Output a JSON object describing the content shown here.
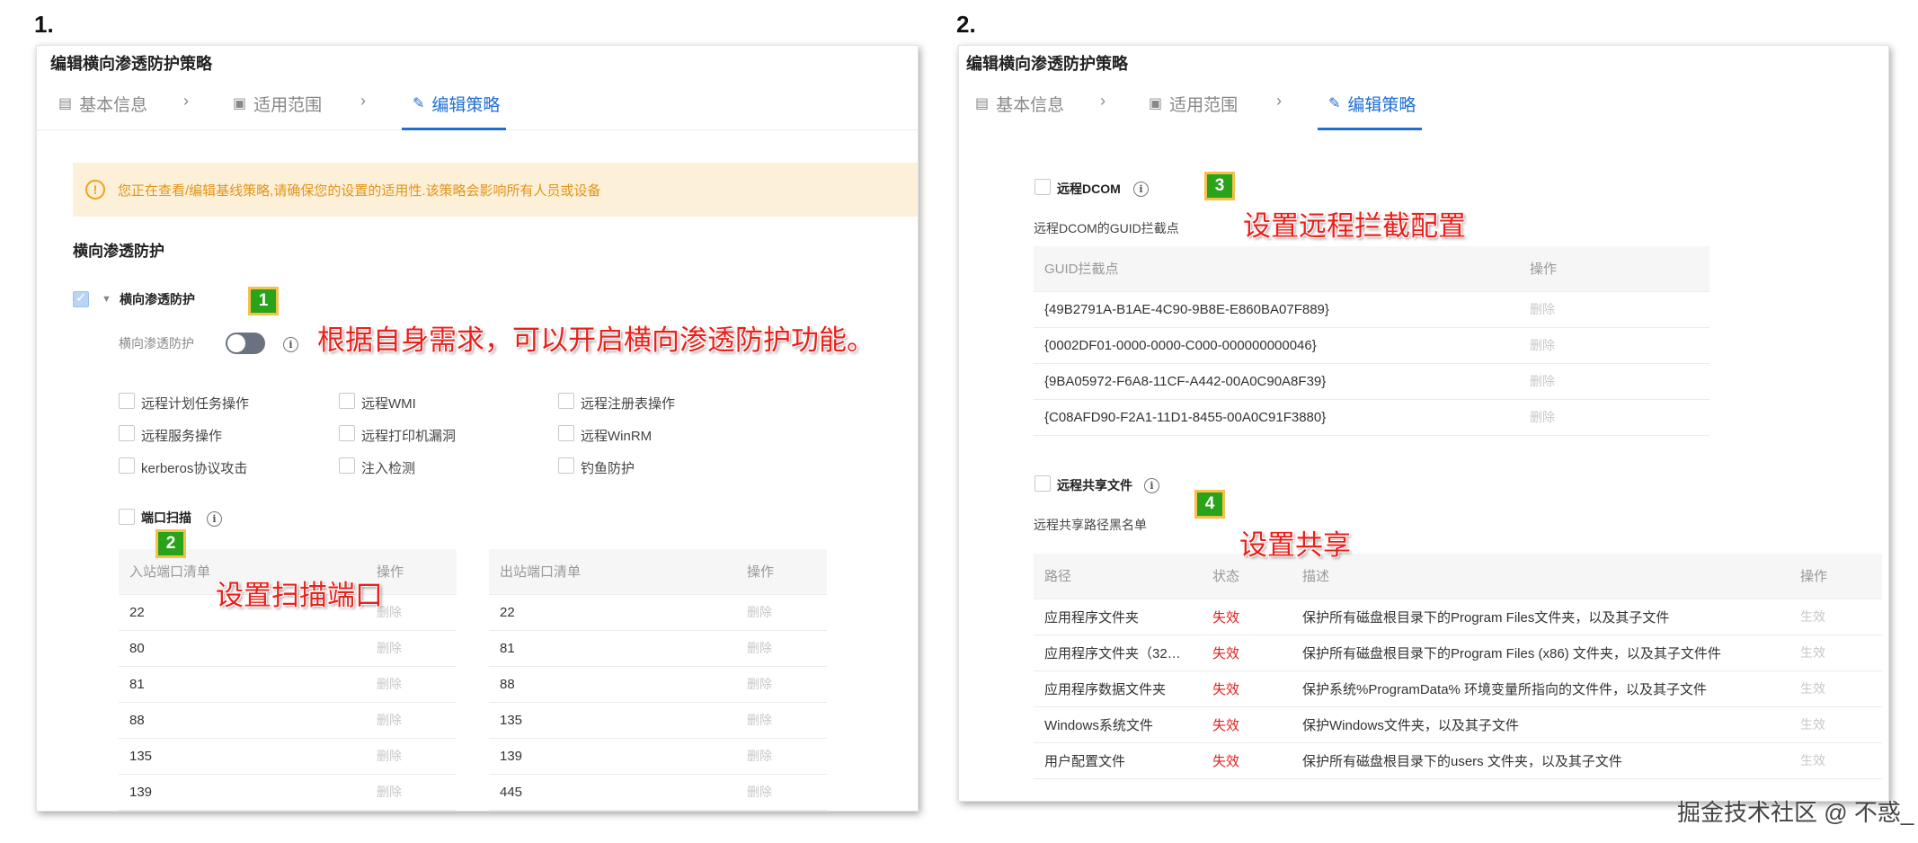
{
  "labels": {
    "left": "1.",
    "right": "2."
  },
  "left": {
    "title": "编辑横向渗透防护策略",
    "steps": [
      {
        "label": "基本信息",
        "icon": "form-icon"
      },
      {
        "label": "适用范围",
        "icon": "scope-icon"
      },
      {
        "label": "编辑策略",
        "icon": "edit-icon",
        "active": true
      }
    ],
    "notice": "您正在查看/编辑基线策略,请确保您的设置的适用性.该策略会影响所有人员或设备",
    "section_title": "横向渗透防护",
    "group_label": "横向渗透防护",
    "toggle_label": "横向渗透防护",
    "options": [
      "远程计划任务操作",
      "远程WMI",
      "远程注册表操作",
      "远程服务操作",
      "远程打印机漏洞",
      "远程WinRM",
      "kerberos协议攻击",
      "注入检测",
      "钓鱼防护"
    ],
    "port_scan_label": "端口扫描",
    "inbound": {
      "headers": [
        "入站端口清单",
        "操作"
      ],
      "rows": [
        {
          "port": "22",
          "action": "删除"
        },
        {
          "port": "80",
          "action": "删除"
        },
        {
          "port": "81",
          "action": "删除"
        },
        {
          "port": "88",
          "action": "删除"
        },
        {
          "port": "135",
          "action": "删除"
        },
        {
          "port": "139",
          "action": "删除"
        }
      ]
    },
    "outbound": {
      "headers": [
        "出站端口清单",
        "操作"
      ],
      "rows": [
        {
          "port": "22",
          "action": "删除"
        },
        {
          "port": "81",
          "action": "删除"
        },
        {
          "port": "88",
          "action": "删除"
        },
        {
          "port": "135",
          "action": "删除"
        },
        {
          "port": "139",
          "action": "删除"
        },
        {
          "port": "445",
          "action": "删除"
        }
      ]
    },
    "badges": [
      "1",
      "2"
    ],
    "annotations": [
      "根据自身需求，可以开启横向渗透防护功能。",
      "设置扫描端口"
    ]
  },
  "right": {
    "title": "编辑横向渗透防护策略",
    "steps": [
      {
        "label": "基本信息",
        "icon": "form-icon"
      },
      {
        "label": "适用范围",
        "icon": "scope-icon"
      },
      {
        "label": "编辑策略",
        "icon": "edit-icon",
        "active": true
      }
    ],
    "dcom_label": "远程DCOM",
    "dcom_sub": "远程DCOM的GUID拦截点",
    "guid_table": {
      "headers": [
        "GUID拦截点",
        "操作"
      ],
      "rows": [
        {
          "guid": "{49B2791A-B1AE-4C90-9B8E-E860BA07F889}",
          "action": "删除"
        },
        {
          "guid": "{0002DF01-0000-0000-C000-000000000046}",
          "action": "删除"
        },
        {
          "guid": "{9BA05972-F6A8-11CF-A442-00A0C90A8F39}",
          "action": "删除"
        },
        {
          "guid": "{C08AFD90-F2A1-11D1-8455-00A0C91F3880}",
          "action": "删除"
        }
      ]
    },
    "share_label": "远程共享文件",
    "share_sub": "远程共享路径黑名单",
    "share_table": {
      "headers": [
        "路径",
        "状态",
        "描述",
        "操作"
      ],
      "rows": [
        {
          "path": "应用程序文件夹",
          "status": "失效",
          "desc": "保护所有磁盘根目录下的Program Files文件夹，以及其子文件",
          "action": "生效"
        },
        {
          "path": "应用程序文件夹（32…",
          "status": "失效",
          "desc": "保护所有磁盘根目录下的Program Files (x86) 文件夹，以及其子文件件",
          "action": "生效"
        },
        {
          "path": "应用程序数据文件夹",
          "status": "失效",
          "desc": "保护系统%ProgramData% 环境变量所指向的文件件，以及其子文件",
          "action": "生效"
        },
        {
          "path": "Windows系统文件",
          "status": "失效",
          "desc": "保护Windows文件夹，以及其子文件",
          "action": "生效"
        },
        {
          "path": "用户配置文件",
          "status": "失效",
          "desc": "保护所有磁盘根目录下的users 文件夹，以及其子文件",
          "action": "生效"
        }
      ]
    },
    "badges": [
      "3",
      "4"
    ],
    "annotations": [
      "设置远程拦截配置",
      "设置共享"
    ]
  },
  "watermark": "掘金技术社区 @ 不惑_",
  "colors": {
    "accent": "#1f6fd6",
    "annotation": "#e8211c",
    "badge": "#29a319",
    "badge_border": "#f6c04b",
    "notice_bg": "#fdf0d8",
    "notice_text": "#e3941a",
    "invalid": "#e0201d"
  }
}
